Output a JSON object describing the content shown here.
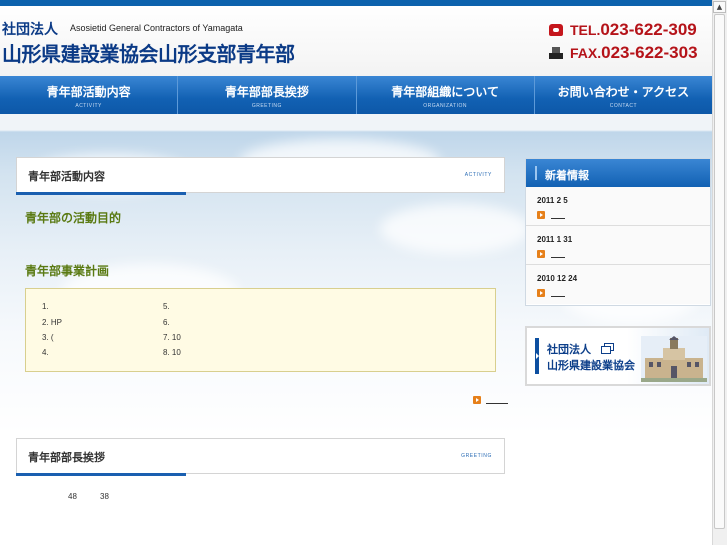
{
  "header": {
    "corp_type": "社団法人",
    "corp_name_en": "Asosietid General Contractors of Yamagata",
    "site_title": "山形県建設業協会山形支部青年部",
    "tel_prefix": "TEL.",
    "tel_number": "023-622-309",
    "fax_prefix": "FAX.",
    "fax_number": "023-622-303"
  },
  "nav": [
    {
      "label": "青年部活動内容",
      "sub": "ACTIVITY"
    },
    {
      "label": "青年部部長挨拶",
      "sub": "GREETING"
    },
    {
      "label": "青年部組織について",
      "sub": "ORGANIZATION"
    },
    {
      "label": "お問い合わせ・アクセス",
      "sub": "CONTACT"
    }
  ],
  "activity": {
    "title": "青年部活動内容",
    "sub": "ACTIVITY",
    "purpose_heading": "青年部の活動目的",
    "plan_heading": "青年部事業計画",
    "plan_items": [
      "1.",
      "2. HP",
      "3.      (",
      "4.",
      "5.",
      "6.",
      "7.         10",
      "8.       10"
    ]
  },
  "greeting": {
    "title": "青年部部長挨拶",
    "sub": "GREETING",
    "num_a": "48",
    "num_b": "38"
  },
  "news": {
    "title": "新着情報",
    "items": [
      {
        "date": "2011  2  5"
      },
      {
        "date": "2011  1  31"
      },
      {
        "date": "2010  12  24"
      }
    ]
  },
  "banner": {
    "line1": "社団法人",
    "line2": "山形県建設業協会"
  },
  "colors": {
    "brand_blue": "#0d62ad",
    "phone_red": "#b51319",
    "green_heading": "#5a7a12",
    "plan_box_bg": "#fffbe4"
  }
}
